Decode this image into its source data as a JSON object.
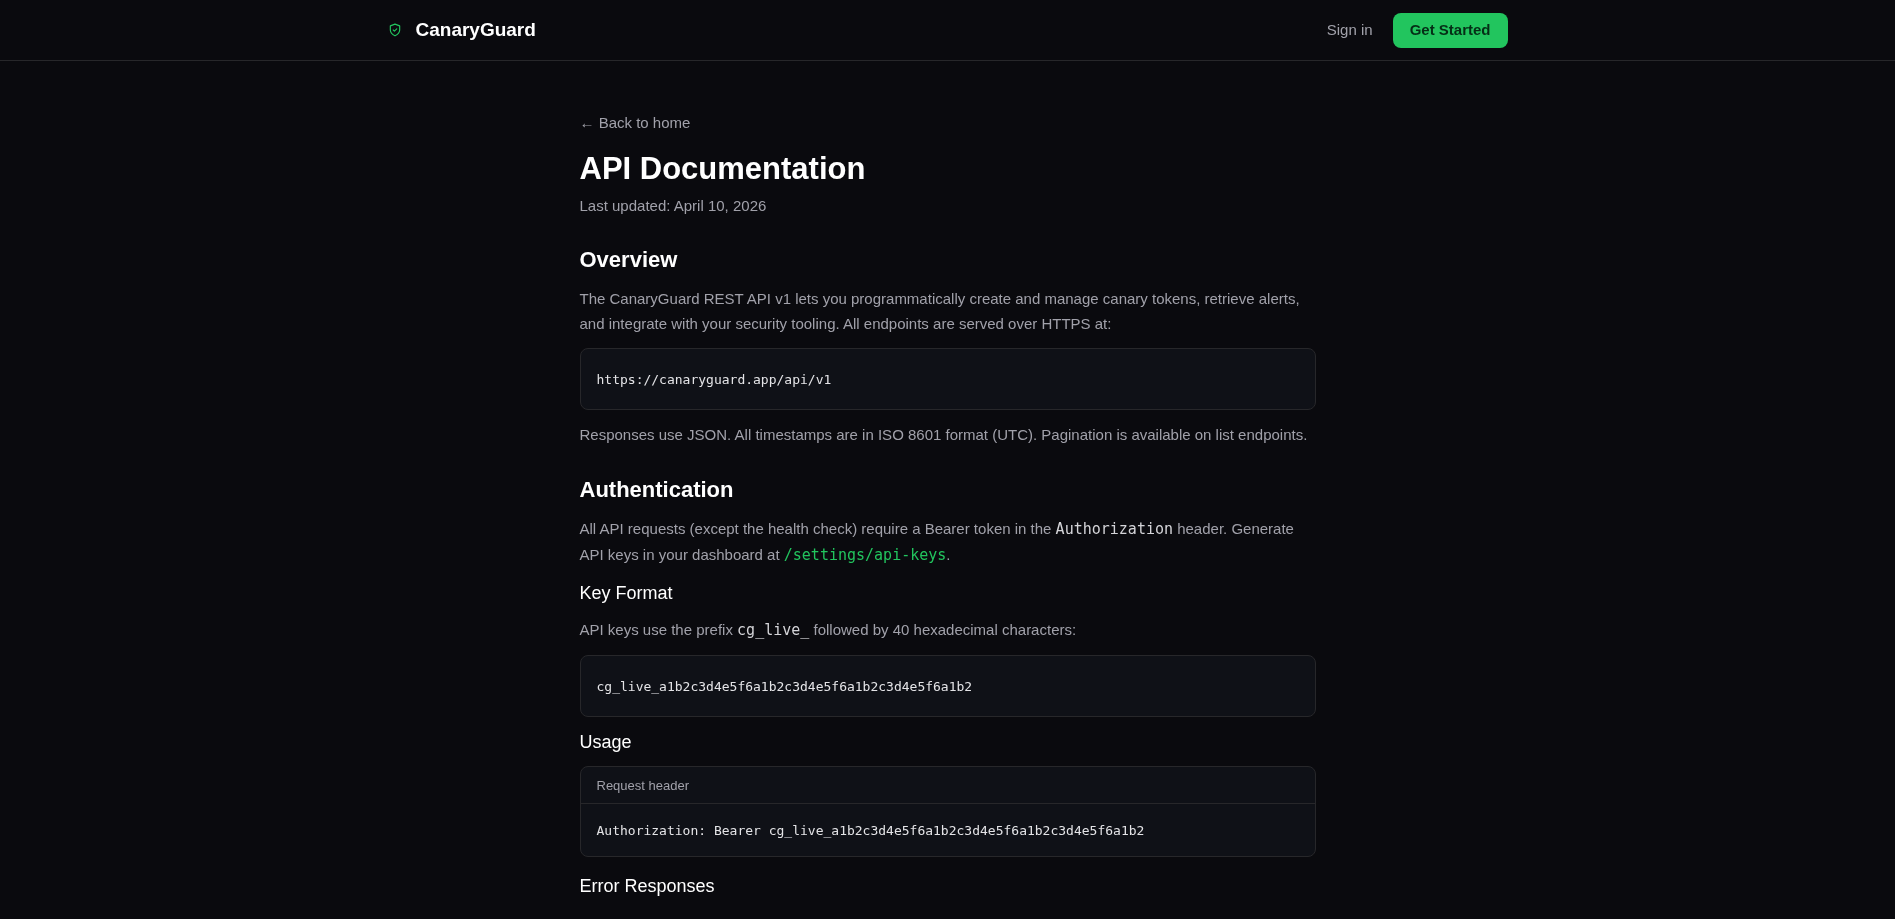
{
  "header": {
    "brand": "CanaryGuard",
    "sign_in": "Sign in",
    "cta": "Get Started"
  },
  "back_link": "← Back to home",
  "title": "API Documentation",
  "updated": "Last updated: April 10, 2026",
  "blocks": [
    {
      "kind": "h2",
      "text": "Overview"
    },
    {
      "kind": "para",
      "parts": [
        {
          "kind": "text",
          "text": "The CanaryGuard REST API v1 lets you programmatically create and manage canary tokens, retrieve alerts, and integrate with your security tooling. All endpoints are served over HTTPS at:"
        }
      ]
    },
    {
      "kind": "code",
      "text": "https://canaryguard.app/api/v1"
    },
    {
      "kind": "para",
      "parts": [
        {
          "kind": "text",
          "text": "Responses use JSON. All timestamps are in ISO 8601 format (UTC). Pagination is available on list endpoints."
        }
      ]
    },
    {
      "kind": "h2",
      "text": "Authentication"
    },
    {
      "kind": "para",
      "parts": [
        {
          "kind": "text",
          "text": "All API requests (except the health check) require a Bearer token in the "
        },
        {
          "kind": "code",
          "text": "Authorization"
        },
        {
          "kind": "text",
          "text": " header. Generate API keys in your dashboard at "
        },
        {
          "kind": "link",
          "text": "/settings/api-keys"
        },
        {
          "kind": "text",
          "text": "."
        }
      ]
    },
    {
      "kind": "h3",
      "text": "Key Format"
    },
    {
      "kind": "para",
      "parts": [
        {
          "kind": "text",
          "text": "API keys use the prefix "
        },
        {
          "kind": "code",
          "text": "cg_live_"
        },
        {
          "kind": "text",
          "text": " followed by 40 hexadecimal characters:"
        }
      ]
    },
    {
      "kind": "code",
      "text": "cg_live_a1b2c3d4e5f6a1b2c3d4e5f6a1b2c3d4e5f6a1b2"
    },
    {
      "kind": "h3",
      "text": "Usage"
    },
    {
      "kind": "code_titled",
      "title": "Request header",
      "text": "Authorization: Bearer cg_live_a1b2c3d4e5f6a1b2c3d4e5f6a1b2c3d4e5f6a1b2"
    },
    {
      "kind": "h3",
      "text": "Error Responses"
    }
  ]
}
